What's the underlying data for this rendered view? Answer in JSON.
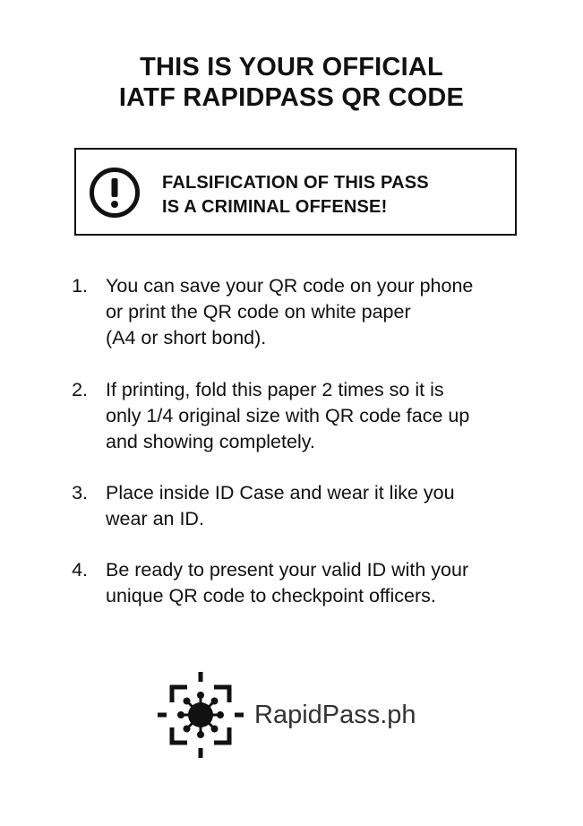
{
  "title": {
    "line1": "THIS IS YOUR OFFICIAL",
    "line2": "IATF RAPIDPASS QR CODE"
  },
  "warning": {
    "icon": "exclamation-circle-icon",
    "line1": "FALSIFICATION OF THIS PASS",
    "line2": "IS A CRIMINAL OFFENSE!"
  },
  "instructions": [
    {
      "number": "1.",
      "lines": [
        "You can save your QR code on your phone",
        "or print the QR code on white paper",
        "(A4 or short bond)."
      ]
    },
    {
      "number": "2.",
      "lines": [
        "If printing, fold this paper 2 times so it is",
        "only 1/4 original size with QR code face up",
        "and showing completely."
      ]
    },
    {
      "number": "3.",
      "lines": [
        "Place inside ID Case and wear it like you",
        "wear an ID."
      ]
    },
    {
      "number": "4.",
      "lines": [
        "Be ready to present your valid ID with your",
        "unique QR code to checkpoint officers."
      ]
    }
  ],
  "logo": {
    "icon": "virus-target-icon",
    "text": "RapidPass.ph"
  }
}
